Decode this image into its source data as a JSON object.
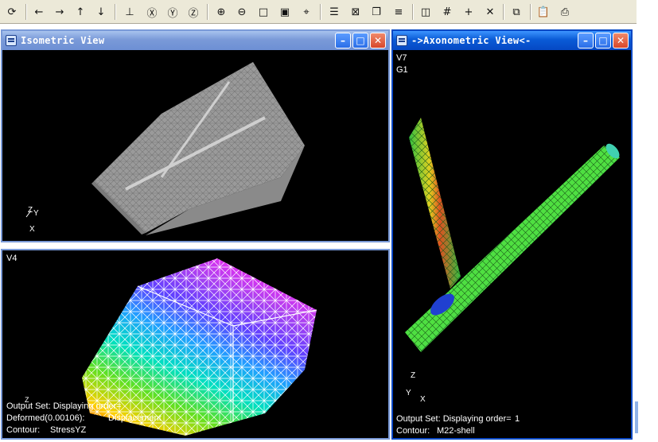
{
  "toolbar": {
    "icons": [
      "cursor-icon",
      "arrow-left-icon",
      "arrow-right-icon",
      "arrow-up-icon",
      "arrow-down-icon",
      "center-axis-icon",
      "rotate-x-icon",
      "rotate-y-icon",
      "rotate-z-icon",
      "zoom-in-icon",
      "zoom-out-icon",
      "zoom-box-icon",
      "fit-icon",
      "crosshair-icon",
      "list-icon",
      "box-x-icon",
      "cube-icon",
      "layers-icon",
      "window-icon",
      "grid-icon",
      "plus-icon",
      "cross-icon",
      "copy-icon",
      "clipboard-icon",
      "print-icon"
    ]
  },
  "windows": {
    "isometric": {
      "title": "Isometric View"
    },
    "v4": {
      "view_label": "V4",
      "output_set": "Output Set: Displaying order=",
      "deformed": "Deformed(0.00106):",
      "deformed_value": "Displacement",
      "contour": "Contour:",
      "contour_value": "StressYZ"
    },
    "axonometric": {
      "title": "->Axonometric View<-",
      "view_label": "V7",
      "group_label": "G1",
      "output_set": "Output Set: Displaying order=",
      "output_order": "1",
      "contour": "Contour:",
      "contour_value": "M22-shell"
    }
  },
  "triad": {
    "z": "Z",
    "y": "Y",
    "x": "X"
  },
  "colors": {
    "title_active": "#0a5bd6",
    "title_inactive": "#7a9ad8",
    "viewport": "#000000"
  }
}
